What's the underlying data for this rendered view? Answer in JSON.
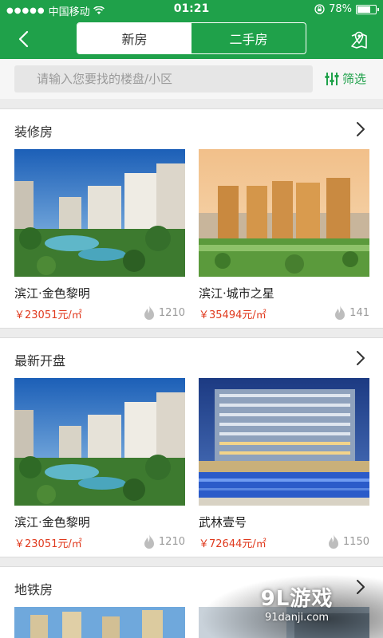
{
  "status_bar": {
    "signal_dots": "●●●●●",
    "carrier": "中国移动",
    "time": "01:21",
    "battery_text": "78%",
    "battery_level": 0.78
  },
  "nav": {
    "tabs": [
      {
        "label": "新房",
        "active": true
      },
      {
        "label": "二手房",
        "active": false
      }
    ]
  },
  "search": {
    "placeholder": "请输入您要找的楼盘/小区",
    "filter_label": "筛选"
  },
  "sections": [
    {
      "title": "装修房",
      "cards": [
        {
          "name": "滨江·金色黎明",
          "price": "￥23051元/㎡",
          "hot": "1210",
          "image": "garden-pool-towers"
        },
        {
          "name": "滨江·城市之星",
          "price": "￥35494元/㎡",
          "hot": "141",
          "image": "golden-towers-sunset"
        }
      ]
    },
    {
      "title": "最新开盘",
      "cards": [
        {
          "name": "滨江·金色黎明",
          "price": "￥23051元/㎡",
          "hot": "1210",
          "image": "garden-pool-towers"
        },
        {
          "name": "武林壹号",
          "price": "￥72644元/㎡",
          "hot": "1150",
          "image": "night-tower-pool"
        }
      ]
    },
    {
      "title": "地铁房",
      "cards": []
    }
  ],
  "watermark": {
    "brand": "9L游戏",
    "url": "91danji.com"
  },
  "colors": {
    "brand_green": "#1fa14a",
    "price_red": "#e03a1e"
  }
}
